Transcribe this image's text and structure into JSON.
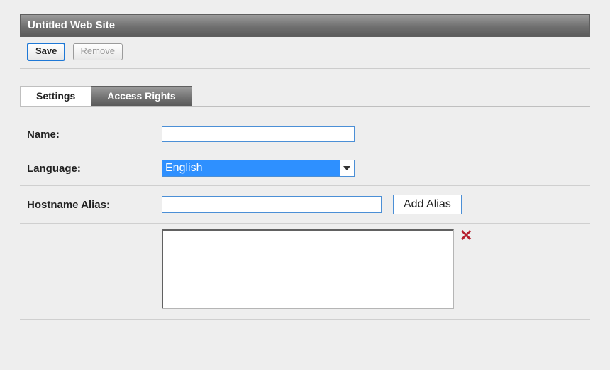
{
  "header": {
    "title": "Untitled Web Site"
  },
  "toolbar": {
    "save": "Save",
    "remove": "Remove"
  },
  "tabs": [
    {
      "label": "Settings",
      "active": true
    },
    {
      "label": "Access Rights",
      "active": false
    }
  ],
  "form": {
    "name": {
      "label": "Name:",
      "value": ""
    },
    "language": {
      "label": "Language:",
      "selected": "English",
      "options": [
        "English"
      ]
    },
    "hostname": {
      "label": "Hostname Alias:",
      "value": "",
      "addButton": "Add Alias"
    },
    "aliasList": {
      "value": "",
      "deleteGlyph": "✕"
    }
  }
}
